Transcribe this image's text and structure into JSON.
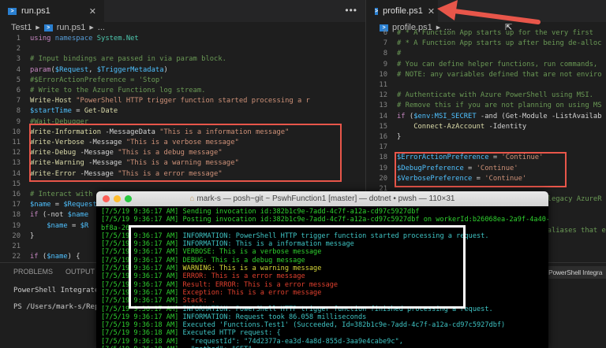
{
  "left_editor": {
    "tab": {
      "label": "run.ps1",
      "icon": "powershell-icon"
    },
    "breadcrumb": [
      "Test1",
      "run.ps1",
      "..."
    ],
    "lines": [
      {
        "n": "1",
        "parts": [
          [
            "kw",
            "using "
          ],
          [
            "nm",
            "namespace "
          ],
          [
            "ty",
            "System.Net"
          ]
        ]
      },
      {
        "n": "2",
        "parts": []
      },
      {
        "n": "3",
        "parts": [
          [
            "cm",
            "# Input bindings are passed in via param block."
          ]
        ]
      },
      {
        "n": "4",
        "parts": [
          [
            "kw",
            "param"
          ],
          [
            "tx",
            "("
          ],
          [
            "vr",
            "$Request"
          ],
          [
            "tx",
            ", "
          ],
          [
            "vr",
            "$TriggerMetadata"
          ],
          [
            "tx",
            ")"
          ]
        ]
      },
      {
        "n": "5",
        "parts": [
          [
            "cm",
            "#$ErrorActionPreference = 'Stop'"
          ]
        ]
      },
      {
        "n": "6",
        "parts": [
          [
            "cm",
            "# Write to the Azure Functions log stream."
          ]
        ]
      },
      {
        "n": "7",
        "parts": [
          [
            "fn",
            "Write-Host "
          ],
          [
            "st",
            "\"PowerShell HTTP trigger function started processing a r"
          ]
        ]
      },
      {
        "n": "8",
        "parts": [
          [
            "vr",
            "$startTime"
          ],
          [
            "tx",
            " = "
          ],
          [
            "fn",
            "Get-Date"
          ]
        ]
      },
      {
        "n": "9",
        "parts": [
          [
            "cm",
            "#Wait-Debugger"
          ]
        ]
      },
      {
        "n": "10",
        "parts": [
          [
            "fn",
            "Write-Information "
          ],
          [
            "tx",
            "-MessageData "
          ],
          [
            "st",
            "\"This is a information message\""
          ]
        ]
      },
      {
        "n": "11",
        "parts": [
          [
            "fn",
            "Write-Verbose "
          ],
          [
            "tx",
            "-Message "
          ],
          [
            "st",
            "\"This is a verbose message\""
          ]
        ]
      },
      {
        "n": "12",
        "parts": [
          [
            "fn",
            "Write-Debug "
          ],
          [
            "tx",
            "-Message "
          ],
          [
            "st",
            "\"This is a debug message\""
          ]
        ]
      },
      {
        "n": "13",
        "parts": [
          [
            "fn",
            "Write-Warning "
          ],
          [
            "tx",
            "-Message "
          ],
          [
            "st",
            "\"This is a warning message\""
          ]
        ]
      },
      {
        "n": "14",
        "parts": [
          [
            "fn",
            "Write-Error "
          ],
          [
            "tx",
            "-Message "
          ],
          [
            "st",
            "\"This is a error message\""
          ]
        ]
      },
      {
        "n": "15",
        "parts": []
      },
      {
        "n": "16",
        "parts": [
          [
            "cm",
            "# Interact with"
          ]
        ]
      },
      {
        "n": "17",
        "parts": [
          [
            "vr",
            "$name"
          ],
          [
            "tx",
            " = "
          ],
          [
            "vr",
            "$Request"
          ]
        ]
      },
      {
        "n": "18",
        "parts": [
          [
            "kw",
            "if "
          ],
          [
            "tx",
            "(-not "
          ],
          [
            "vr",
            "$name"
          ]
        ]
      },
      {
        "n": "19",
        "parts": [
          [
            "tx",
            "    "
          ],
          [
            "vr",
            "$name"
          ],
          [
            "tx",
            " = "
          ],
          [
            "vr",
            "$R"
          ]
        ]
      },
      {
        "n": "20",
        "parts": [
          [
            "tx",
            "}"
          ]
        ]
      },
      {
        "n": "21",
        "parts": []
      },
      {
        "n": "22",
        "parts": [
          [
            "kw",
            "if "
          ],
          [
            "tx",
            "("
          ],
          [
            "vr",
            "$name"
          ],
          [
            "tx",
            ") {"
          ]
        ]
      }
    ]
  },
  "right_editor": {
    "tab": {
      "label": "profile.ps1",
      "icon": "powershell-icon"
    },
    "breadcrumb": [
      "profile.ps1",
      "..."
    ],
    "lines": [
      {
        "n": "6",
        "parts": [
          [
            "cm",
            "# * A Function App starts up for the very first"
          ]
        ]
      },
      {
        "n": "7",
        "parts": [
          [
            "cm",
            "# * A Function App starts up after being de-alloc"
          ]
        ]
      },
      {
        "n": "8",
        "parts": [
          [
            "cm",
            "#"
          ]
        ]
      },
      {
        "n": "9",
        "parts": [
          [
            "cm",
            "# You can define helper functions, run commands,"
          ]
        ]
      },
      {
        "n": "10",
        "parts": [
          [
            "cm",
            "# NOTE: any variables defined that are not enviro"
          ]
        ]
      },
      {
        "n": "11",
        "parts": []
      },
      {
        "n": "12",
        "parts": [
          [
            "cm",
            "# Authenticate with Azure PowerShell using MSI."
          ]
        ]
      },
      {
        "n": "13",
        "parts": [
          [
            "cm",
            "# Remove this if you are not planning on using MS"
          ]
        ]
      },
      {
        "n": "14",
        "parts": [
          [
            "kw",
            "if "
          ],
          [
            "tx",
            "("
          ],
          [
            "vr",
            "$env:MSI_SECRET"
          ],
          [
            "tx",
            " -and (Get-Module -ListAvailab"
          ]
        ]
      },
      {
        "n": "15",
        "parts": [
          [
            "tx",
            "    "
          ],
          [
            "fn",
            "Connect-AzAccount"
          ],
          [
            "tx",
            " -Identity"
          ]
        ]
      },
      {
        "n": "16",
        "parts": [
          [
            "tx",
            "}"
          ]
        ]
      },
      {
        "n": "17",
        "parts": []
      },
      {
        "n": "18",
        "parts": [
          [
            "vr",
            "$ErrorActionPreference"
          ],
          [
            "tx",
            " = "
          ],
          [
            "st",
            "'Continue'"
          ]
        ]
      },
      {
        "n": "19",
        "parts": [
          [
            "vr",
            "$DebugPreference"
          ],
          [
            "tx",
            " = "
          ],
          [
            "st",
            "'Continue'"
          ]
        ]
      },
      {
        "n": "20",
        "parts": [
          [
            "vr",
            "$VerbosePreference"
          ],
          [
            "tx",
            " = "
          ],
          [
            "st",
            "'Continue'"
          ]
        ]
      },
      {
        "n": "21",
        "parts": []
      },
      {
        "n": "22",
        "parts": [
          [
            "cm",
            "                                    legacy AzureR"
          ]
        ]
      },
      {
        "n": "23",
        "parts": []
      },
      {
        "n": "24",
        "parts": []
      },
      {
        "n": "25",
        "parts": [
          [
            "cm",
            "                                    aliases that e"
          ]
        ]
      }
    ],
    "panel_dropdown": "PowerShell Integra"
  },
  "panel": {
    "tabs": [
      "PROBLEMS",
      "OUTPUT"
    ],
    "line1": "PowerShell Integrated",
    "line2": "PS /Users/mark-s/Repo"
  },
  "terminal": {
    "title": "mark-s — posh~git ~ PswhFunction1 [master] — dotnet • pwsh — 110×31",
    "lines": [
      [
        [
          "g",
          "[7/5/19 9:36:17 AM] Sending invocation id:382b1c9e-7add-4c7f-a12a-cd97c5927dbf"
        ]
      ],
      [
        [
          "g",
          "[7/5/19 9:36:17 AM] Posting invocation id:382b1c9e-7add-4c7f-a12a-cd97c5927dbf on workerId:b26068ea-2a9f-4a40-"
        ]
      ],
      [
        [
          "g",
          "bf8a-26"
        ]
      ],
      [
        [
          "g",
          "[7/5/19 9:36:17 AM] "
        ],
        [
          "c",
          "INFORMATION: PowerShell HTTP trigger function started processing a request."
        ]
      ],
      [
        [
          "g",
          "[7/5/19 9:36:17 AM] "
        ],
        [
          "c",
          "INFORMATION: This is a information message"
        ]
      ],
      [
        [
          "g",
          "[7/5/19 9:36:17 AM] VERBOSE: This is a verbose message"
        ]
      ],
      [
        [
          "g",
          "[7/5/19 9:36:17 AM] DEBUG: This is a debug message"
        ]
      ],
      [
        [
          "g",
          "[7/5/19 9:36:17 AM] "
        ],
        [
          "y",
          "WARNING: This is a warning message"
        ]
      ],
      [
        [
          "g",
          "[7/5/19 9:36:17 AM] "
        ],
        [
          "r",
          "ERROR: This is a error message"
        ]
      ],
      [
        [
          "g",
          "[7/5/19 9:36:17 AM] "
        ],
        [
          "r",
          "Result: ERROR: This is a error message"
        ]
      ],
      [
        [
          "g",
          "[7/5/19 9:36:17 AM] "
        ],
        [
          "r",
          "Exception: This is a error message"
        ]
      ],
      [
        [
          "g",
          "[7/5/19 9:36:17 AM] "
        ],
        [
          "r",
          "Stack: ."
        ]
      ],
      [
        [
          "g",
          "[7/5/19 9:36:17 AM] "
        ],
        [
          "c",
          "INFORMATION: PowerShell HTTP trigger function finished processing a request."
        ]
      ],
      [
        [
          "g",
          "[7/5/19 9:36:17 AM] "
        ],
        [
          "c",
          "INFORMATION: Request took 86.058 milliseconds"
        ]
      ],
      [
        [
          "g",
          "[7/5/19 9:36:18 AM] "
        ],
        [
          "c",
          "Executed 'Functions.Test1' (Succeeded, Id=382b1c9e-7add-4c7f-a12a-cd97c5927dbf)"
        ]
      ],
      [
        [
          "g",
          "[7/5/19 9:36:18 AM] "
        ],
        [
          "c",
          "Executed HTTP request: {"
        ]
      ],
      [
        [
          "g",
          "[7/5/19 9:36:18 AM] "
        ],
        [
          "c",
          "  \"requestId\": \"74d2377a-ea3d-4a8d-855d-3aa9e4cabe9c\","
        ]
      ],
      [
        [
          "g",
          "[7/5/19 9:36:18 AM] "
        ],
        [
          "c",
          "  \"method\": \"GET\","
        ]
      ]
    ]
  },
  "colors": {
    "highlight_box": "#e8564a",
    "terminal_box": "#ffffff",
    "arrow": "#e8564a"
  }
}
